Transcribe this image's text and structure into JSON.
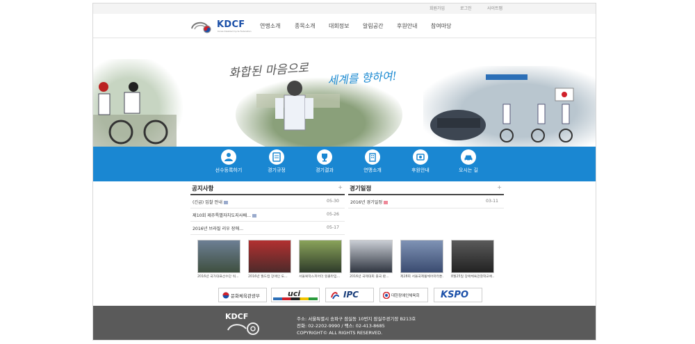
{
  "top_links": [
    "회원가입",
    "로그인",
    "사이트맵"
  ],
  "logo": {
    "text": "KDCF",
    "sub": "Korea Disabled Cycle Federation"
  },
  "menu": [
    "연맹소개",
    "종목소개",
    "대회정보",
    "알림공간",
    "후원안내",
    "참여마당"
  ],
  "banner": {
    "slogan1": "화합된 마음으로",
    "slogan2": "세계를 향하여!"
  },
  "quick_links": [
    "선수등록하기",
    "경기규정",
    "경기결과",
    "연맹소개",
    "후원안내",
    "오시는 길"
  ],
  "notice": {
    "title": "공지사항",
    "more": "+",
    "items": [
      {
        "title": "(긴급) 입찰 안내",
        "date": "05-30"
      },
      {
        "title": "제10회 제주특별자치도지사배...",
        "date": "05-26"
      },
      {
        "title": "2016년 브라질 리우 장애...",
        "date": "05-17"
      }
    ]
  },
  "schedule": {
    "title": "경기일정",
    "more": "+",
    "items": [
      {
        "title": "2016년 경기일정",
        "date": "03-11"
      }
    ]
  },
  "gallery": [
    {
      "caption": "2016년 국가대표선수단 워..."
    },
    {
      "caption": "2016년 월드컵 장애인 도..."
    },
    {
      "caption": "서울북악스피어더 힐클라임..."
    },
    {
      "caption": "2016년 국제대회 출국 환..."
    },
    {
      "caption": "제28회 서울국제휠체어마라톤..."
    },
    {
      "caption": "8월25일 장애체육관찰학교에..."
    }
  ],
  "sponsors": [
    "문화체육관광부",
    "uci",
    "IPC",
    "대한장애인체육회",
    "KSPO"
  ],
  "footer": {
    "logo": "KDCF",
    "address": "주소: 서울특별시 송파구 잠실동 10번지 잠실주경기장 B213호",
    "phone": "전화: 02-2202-9990 / 팩스: 02-413-8685",
    "copyright": "COPYRIGHT© ALL RIGHTS RESERVED."
  },
  "colors": {
    "accent_blue": "#1a87d2",
    "footer_gray": "#5a5a5a"
  }
}
